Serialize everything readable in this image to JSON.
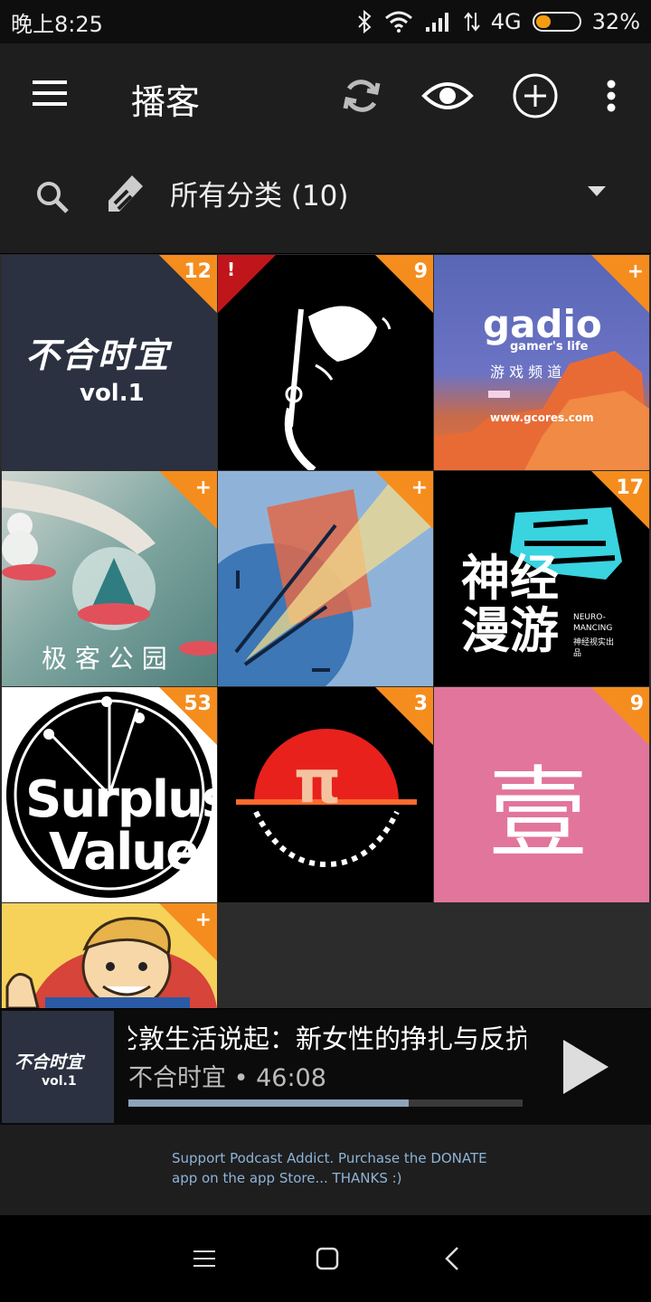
{
  "status_bar": {
    "time": "晚上8:25",
    "network": "4G",
    "battery_percent": "32%",
    "battery_level": 0.32,
    "accent": "#f39c12"
  },
  "toolbar": {
    "title": "播客",
    "menu_icon": "menu-icon",
    "refresh_icon": "refresh-icon",
    "visibility_icon": "eye-icon",
    "add_icon": "add-circle-icon",
    "overflow_icon": "more-vert-icon"
  },
  "filter": {
    "label": "所有分类 (10)",
    "search_icon": "search-icon",
    "tag_icon": "tag-icon"
  },
  "podcasts": [
    {
      "badge": "12",
      "art_text": "不合时宜",
      "art_sub": "vol.1"
    },
    {
      "badge": "9",
      "warning": "!",
      "art_text": ""
    },
    {
      "badge": "+",
      "art_text": "gadio",
      "art_sub": "gamer's life",
      "art_cn": "游 戏 频 道",
      "art_url": "www.gcores.com"
    },
    {
      "badge": "+",
      "art_text": "极 客 公 园"
    },
    {
      "badge": "+",
      "art_text": ""
    },
    {
      "badge": "17",
      "art_text": "神经漫游",
      "art_sub": "NEURO-MANCING",
      "art_cn": "神经视实出品"
    },
    {
      "badge": "53",
      "art_text": "Surplus",
      "art_sub": "Value"
    },
    {
      "badge": "3",
      "art_text": "π"
    },
    {
      "badge": "9",
      "art_text": "壹"
    },
    {
      "badge": "+",
      "art_text": ""
    }
  ],
  "player": {
    "episode_title": "伦敦生活说起：新女性的挣扎与反抗",
    "podcast": "不合时宜",
    "separator": " • ",
    "duration": "46:08",
    "progress": 0.71,
    "thumb_text": "不合时宜",
    "thumb_sub": "vol.1",
    "play_icon": "play-icon"
  },
  "footer": {
    "message": "Support Podcast Addict. Purchase the DONATE app on the app Store... THANKS :)"
  },
  "nav": {
    "recents_icon": "recents-icon",
    "home_icon": "home-icon",
    "back_icon": "back-icon"
  },
  "colors": {
    "badge": "#f58d1e",
    "warning": "#c0151a",
    "toolbar": "#1e1e1e"
  }
}
